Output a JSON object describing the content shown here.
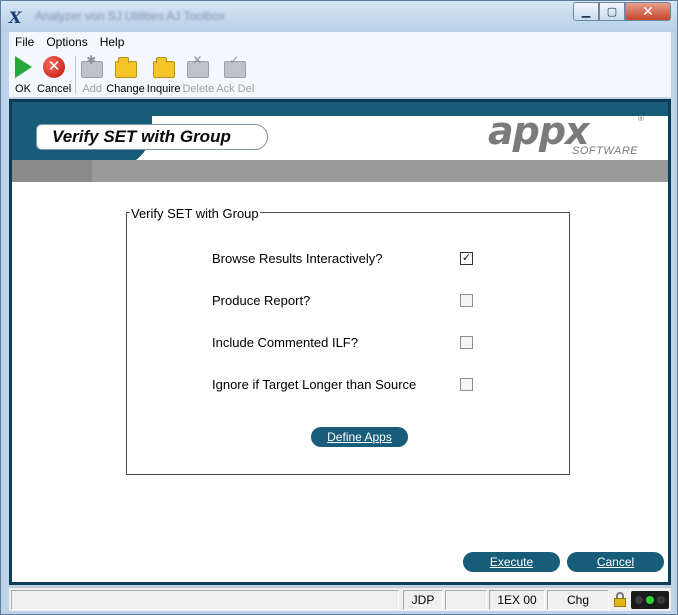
{
  "window": {
    "title": "Analyzer von SJ Utilities AJ Toolbox"
  },
  "menu": [
    "File",
    "Options",
    "Help"
  ],
  "toolbar": [
    {
      "label": "OK",
      "icon": "ok-icon",
      "enabled": true
    },
    {
      "label": "Cancel",
      "icon": "cancel-icon",
      "enabled": true
    },
    {
      "label": "Add",
      "icon": "add-icon",
      "enabled": false
    },
    {
      "label": "Change",
      "icon": "change-icon",
      "enabled": true
    },
    {
      "label": "Inquire",
      "icon": "inquire-icon",
      "enabled": true
    },
    {
      "label": "Delete",
      "icon": "delete-icon",
      "enabled": false
    },
    {
      "label": "Ack Del",
      "icon": "ack-delete-icon",
      "enabled": false
    }
  ],
  "header": {
    "title": "Verify SET with Group",
    "logo_main": "appx",
    "logo_sub": "SOFTWARE",
    "logo_reg": "®"
  },
  "form": {
    "group_label": "Verify SET with Group",
    "fields": [
      {
        "label": "Browse Results Interactively?",
        "checked": true
      },
      {
        "label": "Produce Report?",
        "checked": false
      },
      {
        "label": "Include Commented ILF?",
        "checked": false
      },
      {
        "label": "Ignore if Target Longer than Source",
        "checked": false
      }
    ],
    "define_apps_label": "Define Apps"
  },
  "actions": {
    "execute_label": "Execute",
    "cancel_label": "Cancel"
  },
  "status": {
    "seg_user": "JDP",
    "seg_blank": "",
    "seg_mode": "1EX 00",
    "seg_action": "Chg"
  },
  "colors": {
    "accent": "#175c78",
    "frame": "#0e3d57",
    "ok": "#27a83a",
    "cancel": "#c0130c"
  }
}
